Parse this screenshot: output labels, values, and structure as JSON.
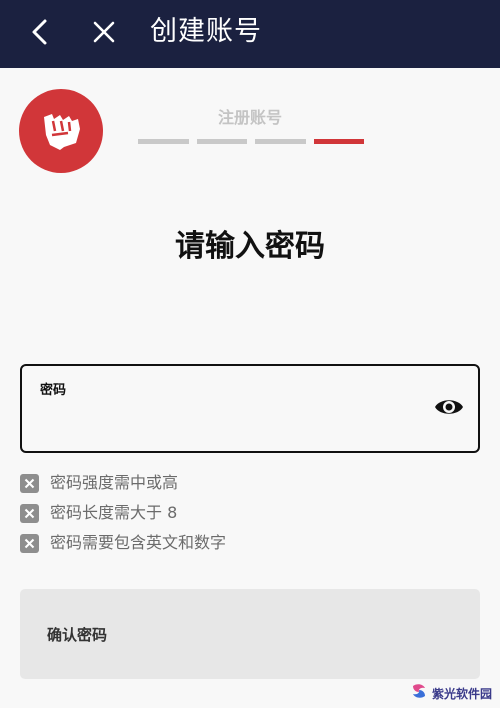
{
  "header": {
    "title": "创建账号",
    "back_icon": "chevron-left-icon",
    "close_icon": "close-icon",
    "background": "#1b2140"
  },
  "logo": {
    "icon": "fist-logo-icon",
    "color": "#d13639"
  },
  "progress": {
    "step_label": "注册账号",
    "total_steps": 4,
    "current_step": 4,
    "active_color": "#d13639",
    "inactive_color": "#c9c9c9"
  },
  "heading": "请输入密码",
  "password_field": {
    "label": "密码",
    "value": "",
    "toggle_icon": "eye-icon"
  },
  "rules": [
    {
      "text": "密码强度需中或高",
      "icon": "x-icon",
      "met": false
    },
    {
      "text": "密码长度需大于 8",
      "icon": "x-icon",
      "met": false
    },
    {
      "text": "密码需要包含英文和数字",
      "icon": "x-icon",
      "met": false
    }
  ],
  "confirm_field": {
    "label": "确认密码"
  },
  "watermark": {
    "text": "紫光软件园"
  }
}
